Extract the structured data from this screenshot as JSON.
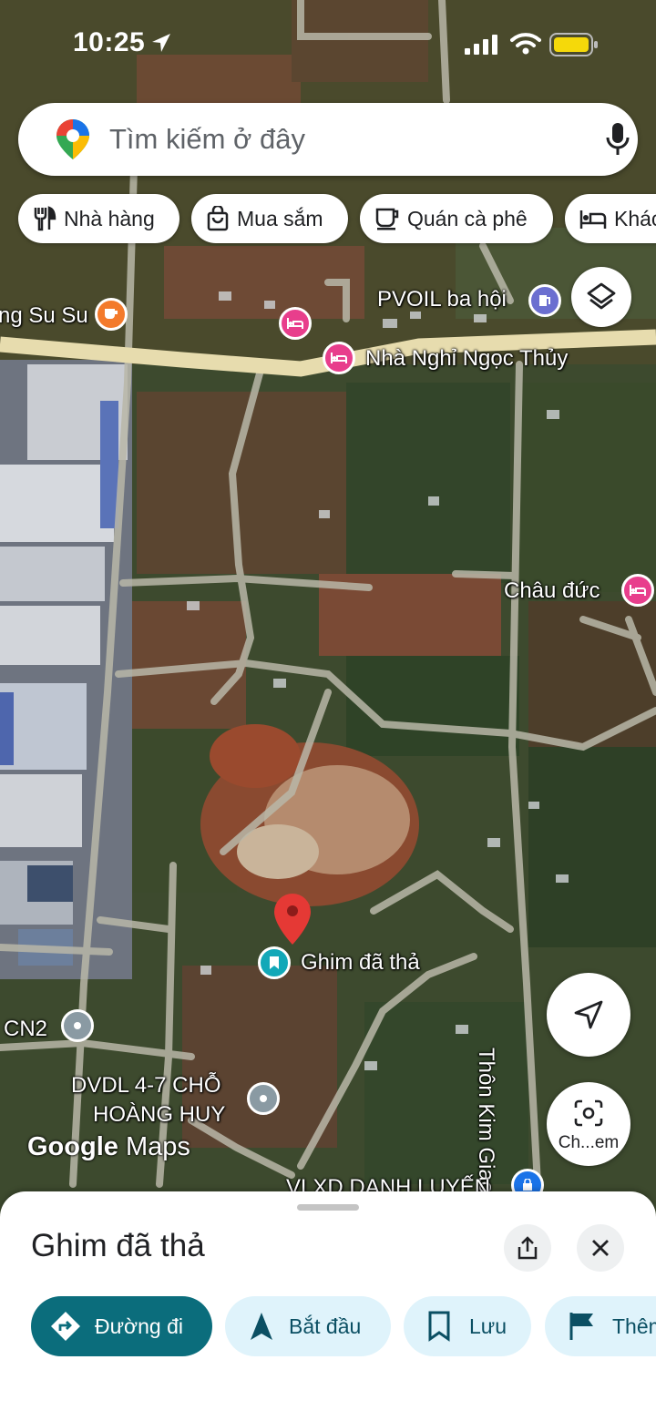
{
  "status_bar": {
    "time": "10:25"
  },
  "search": {
    "placeholder": "Tìm kiếm ở đây"
  },
  "chips": [
    "Nhà hàng",
    "Mua sắm",
    "Quán cà phê",
    "Khác"
  ],
  "map_labels": {
    "cafe": "ng Su Su",
    "pvoil": "PVOIL ba hội",
    "hotel1": "Nhà Nghỉ Ngọc Thủy",
    "hotel2": "Châu đức",
    "pin": "Ghim đã thả",
    "cn2": "CN2",
    "dvdl_line1": "DVDL 4-7 CHỖ",
    "dvdl_line2": "HOÀNG HUY",
    "road": "Thôn Kim Giao",
    "vlxd": "VLXD DANH LUYẾN"
  },
  "lens_label": "Ch...em",
  "logo": {
    "brand": "Google",
    "product": "Maps"
  },
  "sheet": {
    "title": "Ghim đã thả",
    "actions": [
      "Đường đi",
      "Bắt đầu",
      "Lưu",
      "Thêm"
    ]
  },
  "colors": {
    "directions_fill": "#0b6d7c",
    "action_fill": "#dff3fb",
    "hotel_pin": "#e83e8c",
    "cafe_pin": "#f37a2b",
    "fuel_pin": "#6b6fd0",
    "dropped_pin": "#e53935",
    "saved_pin": "#12a8b8",
    "place_pin": "#8a9aa3",
    "shop_pin": "#1a73e8"
  }
}
